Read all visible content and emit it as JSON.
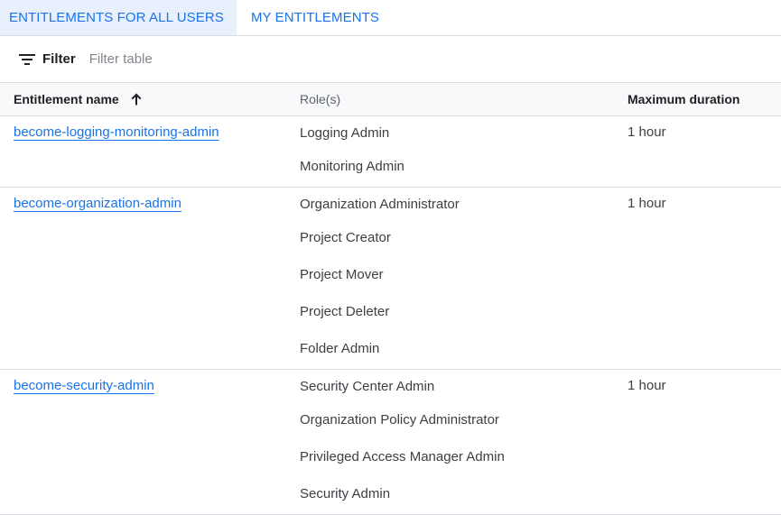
{
  "tabs": [
    {
      "label": "ENTITLEMENTS FOR ALL USERS",
      "active": true
    },
    {
      "label": "MY ENTITLEMENTS",
      "active": false
    }
  ],
  "filter": {
    "label": "Filter",
    "placeholder": "Filter table",
    "icon": "filter-list-icon"
  },
  "table": {
    "columns": {
      "name": "Entitlement name",
      "roles": "Role(s)",
      "duration": "Maximum duration"
    },
    "sort": {
      "column": "name",
      "direction": "ascending",
      "icon": "arrow-up-icon"
    },
    "rows": [
      {
        "name": "become-logging-monitoring-admin",
        "roles": [
          "Logging Admin",
          "Monitoring Admin"
        ],
        "duration": "1 hour"
      },
      {
        "name": "become-organization-admin",
        "roles": [
          "Organization Administrator",
          "Project Creator",
          "Project Mover",
          "Project Deleter",
          "Folder Admin"
        ],
        "duration": "1 hour"
      },
      {
        "name": "become-security-admin",
        "roles": [
          "Security Center Admin",
          "Organization Policy Administrator",
          "Privileged Access Manager Admin",
          "Security Admin"
        ],
        "duration": "1 hour"
      }
    ]
  },
  "colors": {
    "accent": "#1a73e8",
    "active_tab_bg": "#e8f0fe",
    "header_bg": "#f8f9fa",
    "divider": "#dadce0"
  }
}
